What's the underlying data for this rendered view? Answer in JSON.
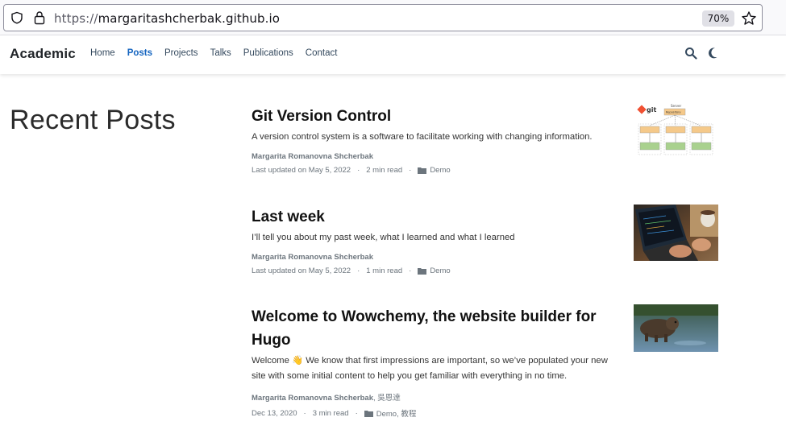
{
  "browser": {
    "url_protocol": "https://",
    "url_host": "margaritashcherbak.github.io",
    "zoom": "70%"
  },
  "nav": {
    "brand": "Academic",
    "links": [
      "Home",
      "Posts",
      "Projects",
      "Talks",
      "Publications",
      "Contact"
    ],
    "active": "Posts"
  },
  "page": {
    "title": "Recent Posts"
  },
  "posts": [
    {
      "title": "Git Version Control",
      "summary": "A version control system is a software to facilitate working with changing information.",
      "author": "Margarita Romanovna Shcherbak",
      "date": "Last updated on May 5, 2022",
      "reading_time": "2 min read",
      "category": "Demo",
      "thumb_labels": {
        "git": "git",
        "server": "Server",
        "repo": "Repository",
        "copy": "Working copy",
        "workstation": "Workstation"
      }
    },
    {
      "title": "Last week",
      "summary": "I’ll tell you about my past week, what I learned and what I learned",
      "author": "Margarita Romanovna Shcherbak",
      "date": "Last updated on May 5, 2022",
      "reading_time": "1 min read",
      "category": "Demo"
    },
    {
      "title": "Welcome to Wowchemy, the website builder for Hugo",
      "summary": "Welcome 👋 We know that first impressions are important, so we’ve populated your new site with some initial content to help you get familiar with everything in no time.",
      "author": "Margarita Romanovna Shcherbak",
      "author_extra": ", 吳恩達",
      "date": "Dec 13, 2020",
      "reading_time": "3 min read",
      "category": "Demo, 教程"
    }
  ]
}
